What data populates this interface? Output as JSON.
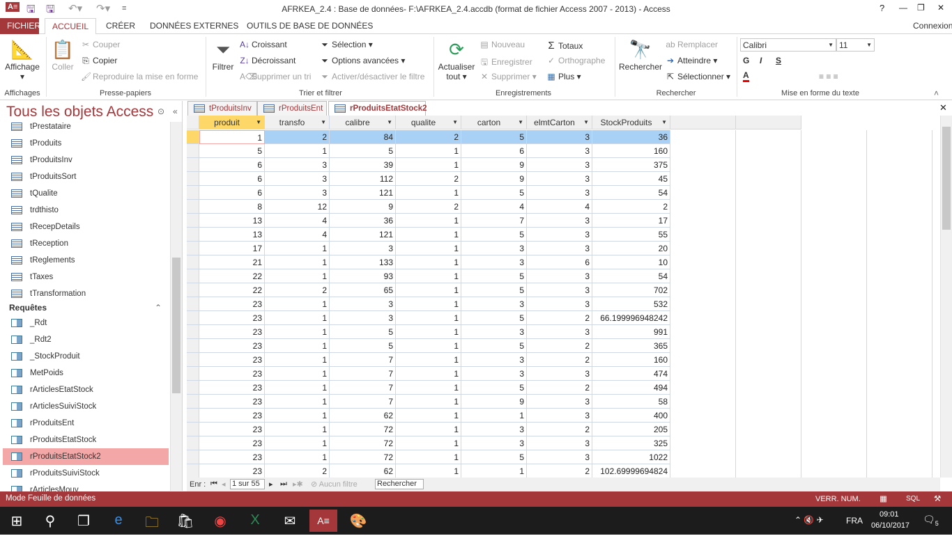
{
  "window": {
    "title": "AFRKEA_2.4 : Base de données- F:\\AFRKEA_2.4.accdb (format de fichier Access 2007 - 2013) - Access",
    "help": "?",
    "minimize": "—",
    "restore": "❐",
    "close": "✕",
    "signin": "Connexion"
  },
  "ribbon_tabs": [
    "FICHIER",
    "ACCUEIL",
    "CRÉER",
    "DONNÉES EXTERNES",
    "OUTILS DE BASE DE DONNÉES"
  ],
  "ribbon": {
    "affichage": "Affichage",
    "affichages_group": "Affichages",
    "coller": "Coller",
    "couper": "Couper",
    "copier": "Copier",
    "reproduire": "Reproduire la mise en forme",
    "presse_group": "Presse-papiers",
    "filtrer": "Filtrer",
    "croissant": "Croissant",
    "decroissant": "Décroissant",
    "supprimer_tri": "Supprimer un tri",
    "selection": "Sélection",
    "options": "Options avancées",
    "activer": "Activer/désactiver le filtre",
    "trier_group": "Trier et filtrer",
    "actualiser": "Actualiser tout",
    "nouveau": "Nouveau",
    "enregistrer": "Enregistrer",
    "supprimer": "Supprimer",
    "totaux": "Totaux",
    "orthographe": "Orthographe",
    "plus": "Plus",
    "enreg_group": "Enregistrements",
    "rechercher": "Rechercher",
    "remplacer": "Remplacer",
    "atteindre": "Atteindre",
    "selectionner": "Sélectionner",
    "rech_group": "Rechercher",
    "font": "Calibri",
    "size": "11",
    "bold": "G",
    "italic": "I",
    "underline": "S",
    "mise_group": "Mise en forme du texte"
  },
  "nav": {
    "title": "Tous les objets Access",
    "section": "Requêtes",
    "tables": [
      "tPrestataire",
      "tProduits",
      "tProduitsInv",
      "tProduitsSort",
      "tQualite",
      "trdthisto",
      "tRecepDetails",
      "tReception",
      "tReglements",
      "tTaxes",
      "tTransformation"
    ],
    "queries": [
      "_Rdt",
      "_Rdt2",
      "_StockProduit",
      "MetPoids",
      "rArticlesEtatStock",
      "rArticlesSuiviStock",
      "rProduitsEnt",
      "rProduitsEtatStock",
      "rProduitsEtatStock2",
      "rProduitsSuiviStock",
      "rArticlesMouv"
    ],
    "selected": "rProduitsEtatStock2"
  },
  "doc_tabs": [
    "tProduitsInv",
    "rProduitsEnt",
    "rProduitsEtatStock2"
  ],
  "columns": [
    "produit",
    "transfo",
    "calibre",
    "qualite",
    "carton",
    "elmtCarton",
    "StockProduits"
  ],
  "rows": [
    [
      "1",
      "2",
      "84",
      "2",
      "5",
      "3",
      "36"
    ],
    [
      "5",
      "1",
      "5",
      "1",
      "6",
      "3",
      "160"
    ],
    [
      "6",
      "3",
      "39",
      "1",
      "9",
      "3",
      "375"
    ],
    [
      "6",
      "3",
      "112",
      "2",
      "9",
      "3",
      "45"
    ],
    [
      "6",
      "3",
      "121",
      "1",
      "5",
      "3",
      "54"
    ],
    [
      "8",
      "12",
      "9",
      "2",
      "4",
      "4",
      "2"
    ],
    [
      "13",
      "4",
      "36",
      "1",
      "7",
      "3",
      "17"
    ],
    [
      "13",
      "4",
      "121",
      "1",
      "5",
      "3",
      "55"
    ],
    [
      "17",
      "1",
      "3",
      "1",
      "3",
      "3",
      "20"
    ],
    [
      "21",
      "1",
      "133",
      "1",
      "3",
      "6",
      "10"
    ],
    [
      "22",
      "1",
      "93",
      "1",
      "5",
      "3",
      "54"
    ],
    [
      "22",
      "2",
      "65",
      "1",
      "5",
      "3",
      "702"
    ],
    [
      "23",
      "1",
      "3",
      "1",
      "3",
      "3",
      "532"
    ],
    [
      "23",
      "1",
      "3",
      "1",
      "5",
      "2",
      "66.199996948242"
    ],
    [
      "23",
      "1",
      "5",
      "1",
      "3",
      "3",
      "991"
    ],
    [
      "23",
      "1",
      "5",
      "1",
      "5",
      "2",
      "365"
    ],
    [
      "23",
      "1",
      "7",
      "1",
      "3",
      "2",
      "160"
    ],
    [
      "23",
      "1",
      "7",
      "1",
      "3",
      "3",
      "474"
    ],
    [
      "23",
      "1",
      "7",
      "1",
      "5",
      "2",
      "494"
    ],
    [
      "23",
      "1",
      "7",
      "1",
      "9",
      "3",
      "58"
    ],
    [
      "23",
      "1",
      "62",
      "1",
      "1",
      "3",
      "400"
    ],
    [
      "23",
      "1",
      "72",
      "1",
      "3",
      "2",
      "205"
    ],
    [
      "23",
      "1",
      "72",
      "1",
      "3",
      "3",
      "325"
    ],
    [
      "23",
      "1",
      "72",
      "1",
      "5",
      "3",
      "1022"
    ],
    [
      "23",
      "2",
      "62",
      "1",
      "1",
      "2",
      "102.69999694824"
    ]
  ],
  "record_nav": {
    "label": "Enr :",
    "position": "1 sur 55",
    "filter": "Aucun filtre",
    "search": "Rechercher"
  },
  "status": {
    "mode": "Mode Feuille de données",
    "numlock": "VERR. NUM.",
    "sql": "SQL"
  },
  "taskbar": {
    "lang": "FRA",
    "time": "09:01",
    "date": "06/10/2017",
    "notifications": "5"
  },
  "colors": {
    "accent": "#a4373a",
    "selected_nav": "#f4a7a7",
    "row_highlight": "#a9d1f5",
    "header_active": "#fdd868"
  }
}
